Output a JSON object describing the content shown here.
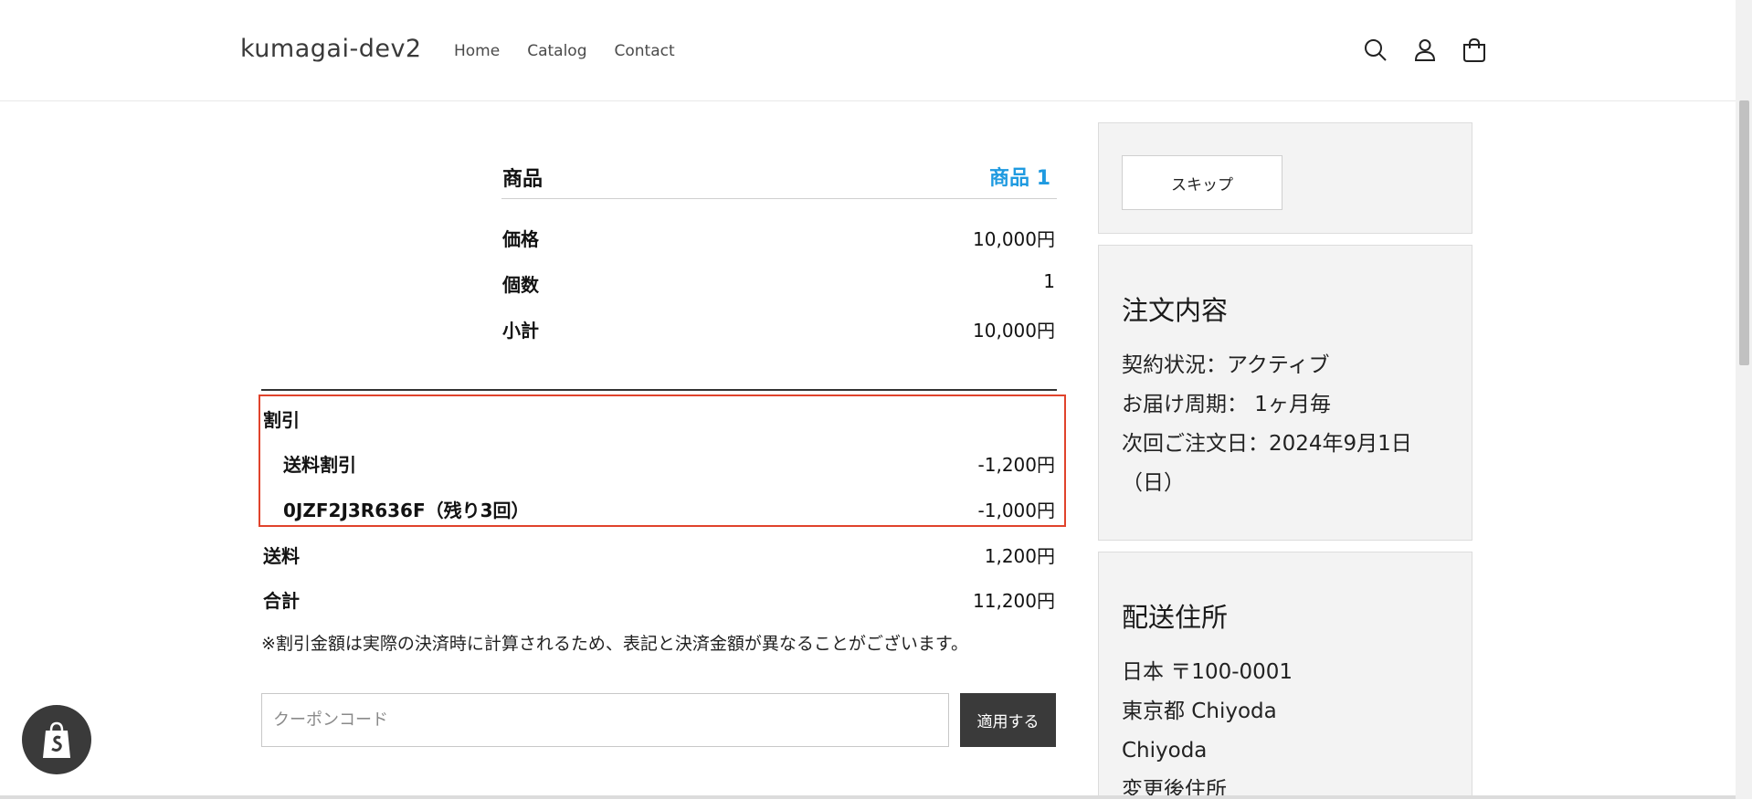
{
  "header": {
    "logo": "kumagai-dev2",
    "nav": [
      "Home",
      "Catalog",
      "Contact"
    ],
    "icons": [
      "search-icon",
      "account-icon",
      "cart-icon"
    ]
  },
  "product": {
    "label": "商品",
    "name": "商品 1",
    "name_color": "#1f9ae0",
    "price_label": "価格",
    "price": "10,000円",
    "qty_label": "個数",
    "qty": "1",
    "subtotal_label": "小計",
    "subtotal": "10,000円"
  },
  "discount": {
    "label": "割引",
    "items": [
      {
        "label": "送料割引",
        "value": "-1,200円"
      },
      {
        "label": "0JZF2J3R636F（残り3回）",
        "value": "-1,000円"
      }
    ]
  },
  "summary": {
    "shipping_label": "送料",
    "shipping": "1,200円",
    "total_label": "合計",
    "total": "11,200円",
    "note": "※割引金額は実際の決済時に計算されるため、表記と決済金額が異なることがございます。"
  },
  "coupon": {
    "placeholder": "クーポンコード",
    "value": "",
    "apply_label": "適用する"
  },
  "sidebar": {
    "skip_label": "スキップ",
    "order": {
      "title": "注文内容",
      "status": "契約状況：アクティブ",
      "cycle": "お届け周期： 1ヶ月毎",
      "next_date": "次回ご注文日：2024年9月1日（日）"
    },
    "address": {
      "title": "配送住所",
      "lines": [
        "日本 〒100-0001",
        "東京都 Chiyoda",
        "Chiyoda",
        "変更後住所"
      ]
    }
  },
  "colors": {
    "accent": "#1f9ae0",
    "highlight_border": "#e0432c",
    "dark_button": "#3a3a3a"
  }
}
